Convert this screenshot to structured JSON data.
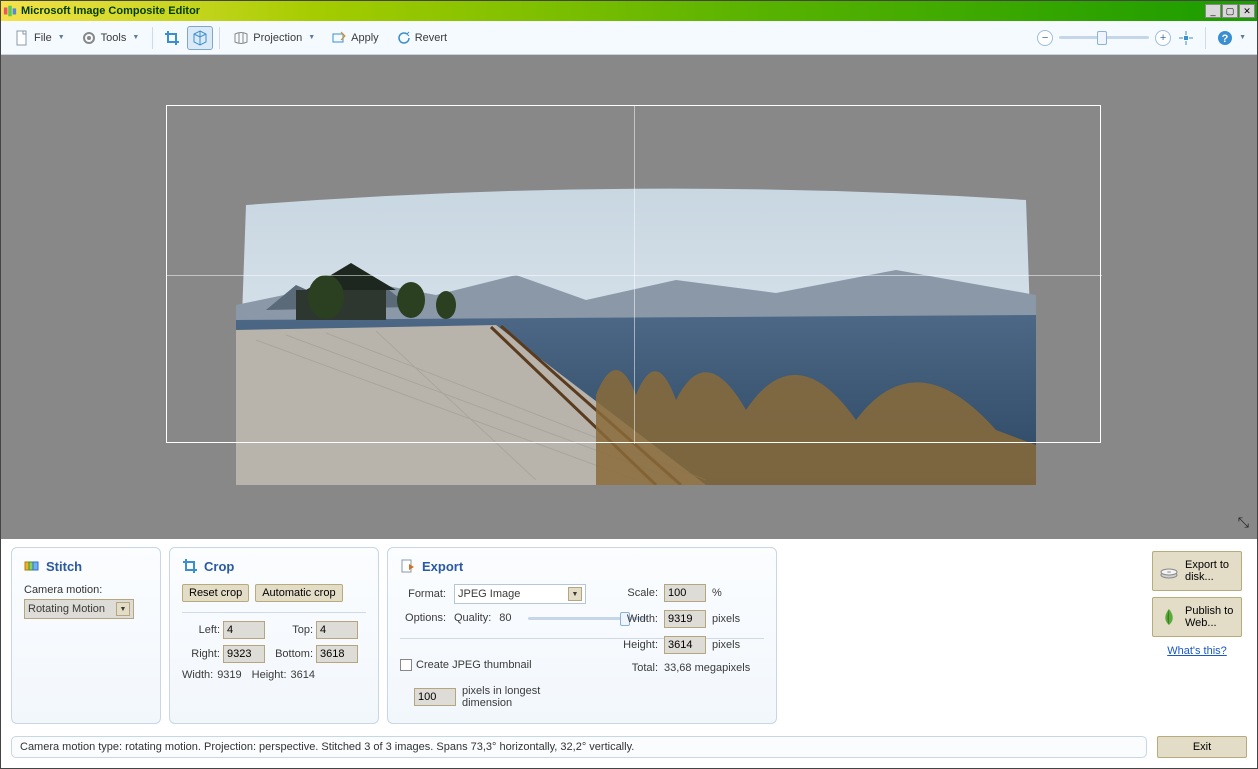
{
  "title": "Microsoft Image Composite Editor",
  "toolbar": {
    "file": "File",
    "tools": "Tools",
    "projection": "Projection",
    "apply": "Apply",
    "revert": "Revert"
  },
  "stitch": {
    "title": "Stitch",
    "camera_motion_label": "Camera motion:",
    "camera_motion_value": "Rotating Motion"
  },
  "crop": {
    "title": "Crop",
    "reset": "Reset crop",
    "auto": "Automatic crop",
    "left_label": "Left:",
    "left": "4",
    "top_label": "Top:",
    "top": "4",
    "right_label": "Right:",
    "right": "9323",
    "bottom_label": "Bottom:",
    "bottom": "3618",
    "width_label": "Width:",
    "width": "9319",
    "height_label": "Height:",
    "height": "3614"
  },
  "export": {
    "title": "Export",
    "format_label": "Format:",
    "format": "JPEG Image",
    "options_label": "Options:",
    "quality_label": "Quality:",
    "quality": "80",
    "thumbnail_label": "Create JPEG thumbnail",
    "thumb_px": "100",
    "thumb_desc": "pixels in longest dimension",
    "scale_label": "Scale:",
    "scale": "100",
    "scale_unit": "%",
    "width_label": "Width:",
    "width": "9319",
    "height_label": "Height:",
    "height": "3614",
    "px_unit": "pixels",
    "total_label": "Total:",
    "total": "33,68 megapixels"
  },
  "right": {
    "export_disk": "Export to disk...",
    "publish_web": "Publish to Web...",
    "whats_this": "What's this?"
  },
  "status": "Camera motion type: rotating motion. Projection: perspective. Stitched 3 of 3 images. Spans 73,3° horizontally, 32,2° vertically.",
  "exit": "Exit"
}
